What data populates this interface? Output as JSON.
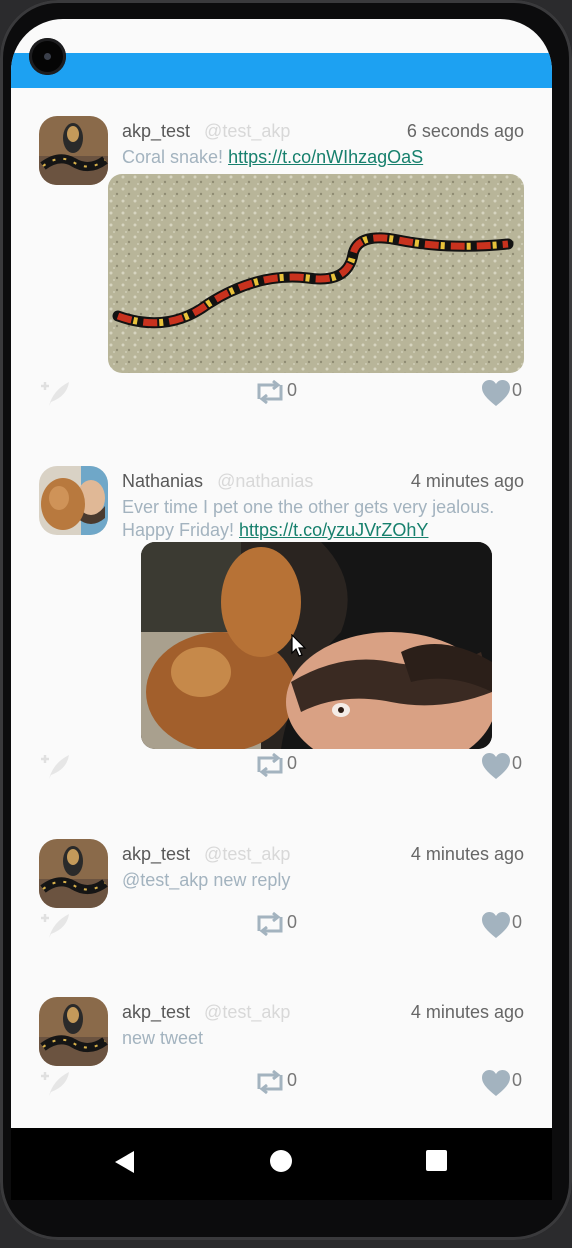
{
  "tweets": [
    {
      "username": "akp_test",
      "handle": "@test_akp",
      "time": "6 seconds ago",
      "text": "Coral snake! ",
      "link": "https://t.co/nWIhzagOaS",
      "media": "coral snake photo",
      "retweets": "0",
      "likes": "0"
    },
    {
      "username": "Nathanias",
      "handle": "@nathanias",
      "time": "4 minutes ago",
      "text": "Ever time I pet one the other gets very jealous. Happy Friday! ",
      "link": "https://t.co/yzuJVrZOhY",
      "media": "man with dog selfie",
      "retweets": "0",
      "likes": "0"
    },
    {
      "username": "akp_test",
      "handle": "@test_akp",
      "time": "4 minutes ago",
      "text": "@test_akp new reply",
      "retweets": "0",
      "likes": "0"
    },
    {
      "username": "akp_test",
      "handle": "@test_akp",
      "time": "4 minutes ago",
      "text": "new tweet",
      "retweets": "0",
      "likes": "0"
    }
  ],
  "colors": {
    "appbar": "#1da1f2",
    "link": "#17806d",
    "icon": "#a3b3bf"
  },
  "icons": [
    "reply-icon",
    "retweet-icon",
    "heart-icon",
    "back-icon",
    "home-icon",
    "recents-icon"
  ]
}
